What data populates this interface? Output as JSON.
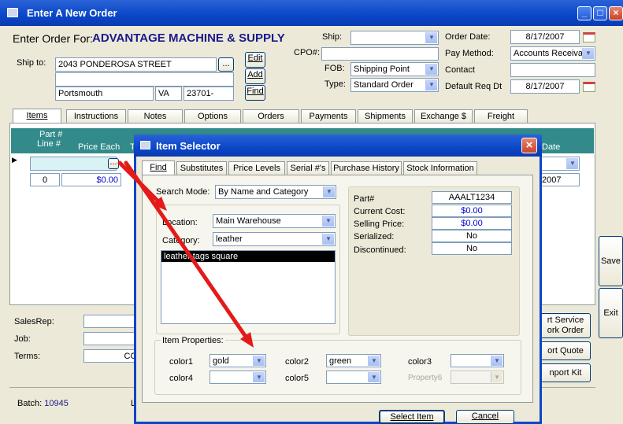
{
  "main": {
    "title": "Enter A New Order",
    "enter_for_label": "Enter Order For:",
    "customer": "ADVANTAGE MACHINE & SUPPLY",
    "ship_to_label": "Ship to:",
    "address1": "2043 PONDEROSA STREET",
    "address2": "",
    "city": "Portsmouth",
    "state": "VA",
    "zip": "23701-",
    "browse_btn": "...",
    "edit_btn": "Edit",
    "add_btn": "Add",
    "find_btn": "Find",
    "ship_label": "Ship:",
    "ship_value": "",
    "cpo_label": "CPO#:",
    "cpo_value": "",
    "fob_label": "FOB:",
    "fob_value": "Shipping Point",
    "type_label": "Type:",
    "type_value": "Standard Order",
    "order_date_label": "Order Date:",
    "order_date": "8/17/2007",
    "pay_method_label": "Pay Method:",
    "pay_method": "Accounts Receiva",
    "contact_label": "Contact",
    "contact_value": "",
    "default_req_label": "Default Req Dt",
    "default_req_date": "8/17/2007",
    "tabs": [
      "Items",
      "Instructions",
      "Notes",
      "Options",
      "Orders",
      "Payments",
      "Shipments",
      "Exchange $",
      "Freight"
    ],
    "grid_header_part": "Part #",
    "grid_header_line": "Line #",
    "grid_header_price": "Price Each",
    "grid_header_t": "T",
    "grid_header_date": "Date",
    "row_line": "0",
    "row_price": "$0.00",
    "row_date": "2007",
    "salesrep_label": "SalesRep:",
    "job_label": "Job:",
    "terms_label": "Terms:",
    "terms_value": "CO",
    "batch_label": "Batch:",
    "batch_value": "10945",
    "bottom_l": "L",
    "save_btn": "Save",
    "exit_btn": "Exit",
    "start_service_btn": "rt Service",
    "work_order_btn": "ork Order",
    "quote_btn": "ort Quote",
    "kit_btn": "nport Kit"
  },
  "dialog": {
    "title": "Item Selector",
    "tabs": [
      "Find",
      "Substitutes",
      "Price Levels",
      "Serial #'s",
      "Purchase History",
      "Stock Information"
    ],
    "search_mode_label": "Search Mode:",
    "search_mode": "By Name and Category",
    "location_label": "Location:",
    "location": "Main Warehouse",
    "category_label": "Category:",
    "category": "leather",
    "list_items": [
      "leather tags square"
    ],
    "info": {
      "part_label": "Part#",
      "part_value": "AAALT1234",
      "cost_label": "Current Cost:",
      "cost_value": "$0.00",
      "sell_label": "Selling Price:",
      "sell_value": "$0.00",
      "serialized_label": "Serialized:",
      "serialized_value": "No",
      "discontinued_label": "Discontinued:",
      "discontinued_value": "No"
    },
    "props_label": "Item Properties:",
    "color1_label": "color1",
    "color1": "gold",
    "color2_label": "color2",
    "color2": "green",
    "color3_label": "color3",
    "color3": "",
    "color4_label": "color4",
    "color4": "",
    "color5_label": "color5",
    "color5": "",
    "property6_label": "Property6",
    "property6": "",
    "select_btn": "Select Item",
    "cancel_btn": "Cancel"
  },
  "colors": {
    "titlebar": "#0a46c8",
    "grid_header": "#338a8a",
    "arrow": "#e41a1a",
    "money": "#0000cc"
  }
}
